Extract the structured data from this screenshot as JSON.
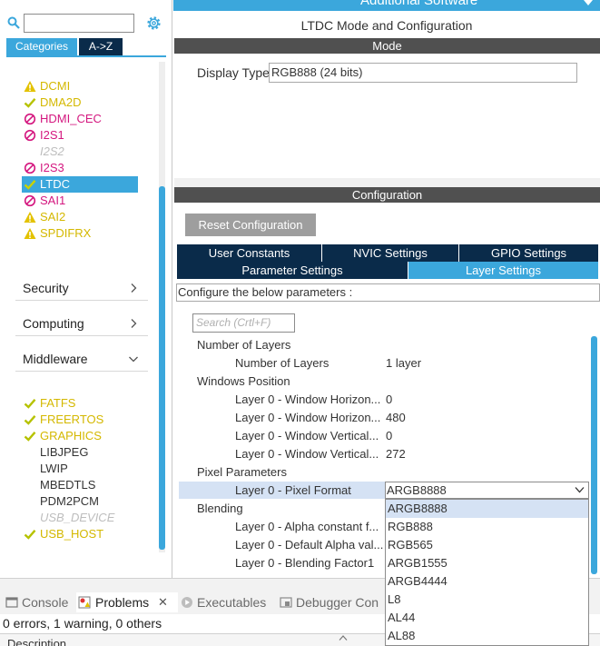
{
  "left_panel": {
    "tabs": {
      "categories": "Categories",
      "az": "A->Z"
    },
    "items": [
      {
        "label": "DCMI",
        "status": "warning"
      },
      {
        "label": "DMA2D",
        "status": "ok"
      },
      {
        "label": "HDMI_CEC",
        "status": "disabled"
      },
      {
        "label": "I2S1",
        "status": "disabled"
      },
      {
        "label": "I2S2",
        "status": "unavailable"
      },
      {
        "label": "I2S3",
        "status": "disabled"
      },
      {
        "label": "LTDC",
        "status": "ok",
        "selected": true
      },
      {
        "label": "SAI1",
        "status": "disabled"
      },
      {
        "label": "SAI2",
        "status": "warning"
      },
      {
        "label": "SPDIFRX",
        "status": "warning"
      }
    ],
    "sections": [
      {
        "label": "Security",
        "state": "collapsed"
      },
      {
        "label": "Computing",
        "state": "collapsed"
      },
      {
        "label": "Middleware",
        "state": "expanded"
      }
    ],
    "middleware_items": [
      {
        "label": "FATFS",
        "status": "ok"
      },
      {
        "label": "FREERTOS",
        "status": "ok"
      },
      {
        "label": "GRAPHICS",
        "status": "ok"
      },
      {
        "label": "LIBJPEG",
        "status": "none"
      },
      {
        "label": "LWIP",
        "status": "none"
      },
      {
        "label": "MBEDTLS",
        "status": "none"
      },
      {
        "label": "PDM2PCM",
        "status": "none"
      },
      {
        "label": "USB_DEVICE",
        "status": "unavailable"
      },
      {
        "label": "USB_HOST",
        "status": "ok"
      }
    ]
  },
  "header": {
    "additional_software": "Additional Software",
    "title": "LTDC Mode and Configuration"
  },
  "mode": {
    "bar_label": "Mode",
    "display_type_label": "Display Type",
    "display_type_value": "RGB888 (24 bits)"
  },
  "configuration": {
    "bar_label": "Configuration",
    "reset_label": "Reset Configuration",
    "tabs": {
      "user_constants": "User Constants",
      "nvic": "NVIC Settings",
      "gpio": "GPIO Settings",
      "parameter": "Parameter Settings",
      "layer": "Layer Settings"
    },
    "configure_text": "Configure the below parameters :",
    "search_placeholder": "Search (Crtl+F)",
    "groups": [
      {
        "name": "Number of Layers",
        "params": [
          {
            "label": "Number of Layers",
            "value": "1 layer"
          }
        ]
      },
      {
        "name": "Windows Position",
        "params": [
          {
            "label": "Layer 0 - Window Horizon...",
            "value": "0"
          },
          {
            "label": "Layer 0 - Window Horizon...",
            "value": "480"
          },
          {
            "label": "Layer 0 - Window Vertical...",
            "value": "0"
          },
          {
            "label": "Layer 0 - Window Vertical...",
            "value": "272"
          }
        ]
      },
      {
        "name": "Pixel Parameters",
        "params": [
          {
            "label": "Layer 0 - Pixel Format",
            "value": "ARGB8888"
          }
        ]
      },
      {
        "name": "Blending",
        "params": [
          {
            "label": "Layer 0 - Alpha constant f...",
            "value": ""
          },
          {
            "label": "Layer 0 - Default Alpha val...",
            "value": ""
          },
          {
            "label": "Layer 0 - Blending Factor1",
            "value": ""
          }
        ]
      }
    ],
    "pixel_format_options": [
      "ARGB8888",
      "RGB888",
      "RGB565",
      "ARGB1555",
      "ARGB4444",
      "L8",
      "AL44",
      "AL88"
    ]
  },
  "console": {
    "tabs": [
      {
        "label": "Console"
      },
      {
        "label": "Problems"
      },
      {
        "label": "Executables"
      },
      {
        "label": "Debugger Con"
      }
    ],
    "summary": "0 errors, 1 warning, 0 others",
    "column_header": "Description"
  },
  "colors": {
    "accent": "#3ba7dc",
    "dark_tab": "#0a2b4a",
    "bar": "#505050",
    "ok": "#c9b500",
    "warning": "#d4b800",
    "disabled": "#d4177f",
    "selection": "#d5e2f4"
  }
}
